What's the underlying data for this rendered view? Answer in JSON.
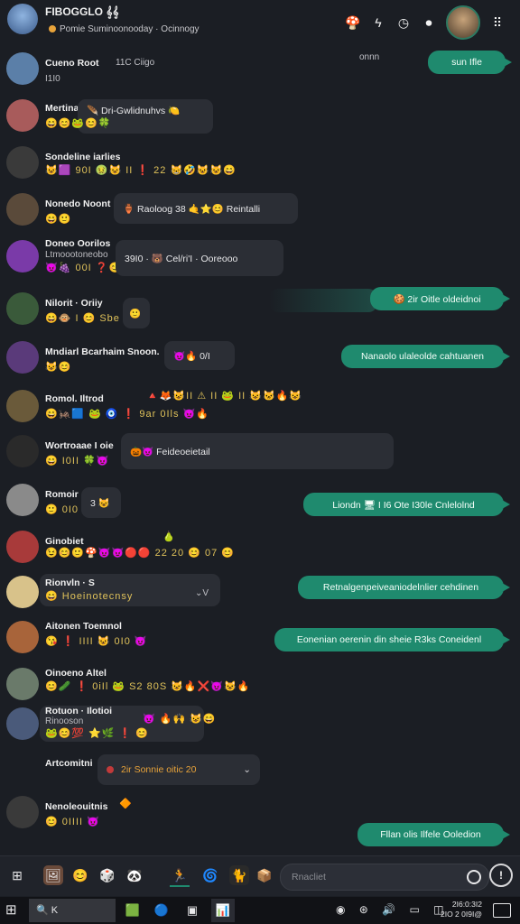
{
  "header": {
    "title": "FIBOGGLO 𝄞𝄞",
    "subtitle": "Pomie Suminoonooday  ·  Ocinnogy",
    "icons": [
      "mushroom-icon",
      "bolt-icon",
      "clock-icon",
      "mic-icon"
    ],
    "menu_icon": "⠿"
  },
  "messages": [
    {
      "name": "Cueno Root",
      "time": "11C Ciigo",
      "sub": "I1I0",
      "avatar": "#5b7fa8",
      "out_meta": "onnn",
      "out_text": "sun Ifle"
    },
    {
      "name": "Mertina",
      "bubble": "🪶 Dri-Gwlidnuhvs 🍋",
      "emojis": "😄😊🐸😊🍀",
      "avatar": "#a85b5b"
    },
    {
      "name": "Sondeline iarlies",
      "emojis": "😺🟪 90I 🤢😺 II ❗ 22 😸🤣😺😺😄",
      "avatar": "#3a3a3a"
    },
    {
      "name": "Nonedo Noont",
      "emojis": "😄🙂",
      "bubble": "🏺 Raoloog  38  🤙⭐😊 Reintalli",
      "avatar": "#5a4a3a"
    },
    {
      "name": "Doneo Oorilos",
      "sub": "Ltmoootoneobo",
      "emojis": "😈🍇 00I ❓😊😺",
      "bubble": "39I0   ·   🐻 Cel/ri'I  ·   Ooreooo",
      "avatar": "#7a3aa8"
    },
    {
      "name": "Nilorit  ·  Oriiy",
      "emojis": "😄🐵 I 😊 Sbe",
      "bubble": "🙂",
      "avatar": "#3a5a3a",
      "out_text": "🍪 2ir Oitle oldeidnoi"
    },
    {
      "name": "Mndiarl Bcarhaim Snoon.",
      "emojis": "😺😊",
      "bubble": "😈🔥 0/I",
      "avatar": "#5a3a7a",
      "out_text": "Nanaolo ulaleolde cahtuanen"
    },
    {
      "name": "Romol. Iltrod",
      "emojis": "😄🦗🟦 🐸 🧿 ❗ 9ar 0Ils 😈🔥",
      "top_emojis": "🔺🦊😺II ⚠ II 🐸 II 😺🐱🔥😺",
      "avatar": "#6a5a3a"
    },
    {
      "name": "Wortroaae I oie",
      "emojis": "😄 I0II 🍀😈",
      "bubble": "🎃😈 Feideoeietail",
      "avatar": "#2a2a2a"
    },
    {
      "name": "Romoir",
      "emojis": "🙂 0I0",
      "bubble": "3 😺",
      "avatar": "#8a8a8a",
      "out_text": "Liondn  🖥  I  I6 Ote I30le Cnlelolnd"
    },
    {
      "name": "Ginobiet",
      "emojis": "😉😊🙂🍄😈😈🔴🔴 22 20 😊 07 😊",
      "top_emojis": "🍐",
      "avatar": "#a83a3a"
    },
    {
      "name": "Rionvln  ·  S",
      "emojis": "😄 Hoeinotecnsy",
      "bubble_right": "⌄V",
      "avatar": "#d8c28a",
      "out_text": "Retnalgenpeiveaniodelnlier cehdinen"
    },
    {
      "name": "Aitonen Toemnol",
      "emojis": "😘 ❗ IIII 😺 0I0 😈",
      "avatar": "#a8643a",
      "out_text": "Eonenian oerenin din sheie R3ks Coneidenl"
    },
    {
      "name": "Oinoeno Altel",
      "emojis": "😊🥒 ❗ 0iIl 🐸 S2 80S 😺🔥❌😈😺🔥",
      "avatar": "#6a7a6a"
    },
    {
      "name": "Rotuon  ·  Ilotioi",
      "sub": "Rinooson",
      "emojis": "🐸😊💯 ⭐🌿 ❗ 😊",
      "bubble": "😈 🔥🙌 😺😄",
      "avatar": "#4a5a7a"
    },
    {
      "name": "Artcomitni",
      "select": "2ir  Sonnie oitic  20",
      "avatar": ""
    },
    {
      "name": "Nenoleouitnis",
      "emojis": "😊 0IIII 😈",
      "top_emojis": "🔶",
      "avatar": "#3a3a3a",
      "out_text": "Fllan olis Ilfele Ooledion"
    }
  ],
  "dock": {
    "icons": [
      "windows-icon",
      "photo-icon",
      "sticker-icon",
      "game-icon",
      "panda-icon",
      "runner-icon",
      "spinner-icon",
      "cat-icon",
      "box-icon"
    ],
    "search_placeholder": "Rnacliet",
    "info": "!"
  },
  "taskbar": {
    "search_label": "🔍  K",
    "tray": "◉ ⊛ 🔊 ▭ ◫",
    "clock_line1": "2I6:0:3I2",
    "clock_line2": "2IO 2 0I9I@"
  },
  "colors": {
    "background": "#1b1e24",
    "incoming_bubble": "#2b2e35",
    "outgoing_bubble": "#1f8a6e"
  }
}
